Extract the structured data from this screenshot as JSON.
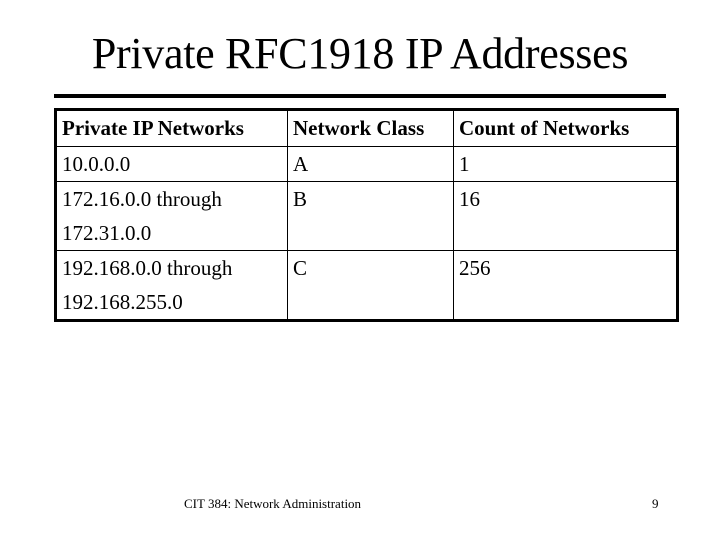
{
  "slide": {
    "title": "Private RFC1918 IP Addresses",
    "footer": "CIT 384: Network Administration",
    "page_number": "9"
  },
  "table": {
    "headers": [
      "Private IP Networks",
      "Network Class",
      "Count of Networks"
    ],
    "rows": [
      {
        "network_lines": [
          "10.0.0.0"
        ],
        "class": "A",
        "count": "1"
      },
      {
        "network_lines": [
          "172.16.0.0 through",
          "172.31.0.0"
        ],
        "class": "B",
        "count": "16"
      },
      {
        "network_lines": [
          "192.168.0.0 through",
          "192.168.255.0"
        ],
        "class": "C",
        "count": "256"
      }
    ]
  }
}
